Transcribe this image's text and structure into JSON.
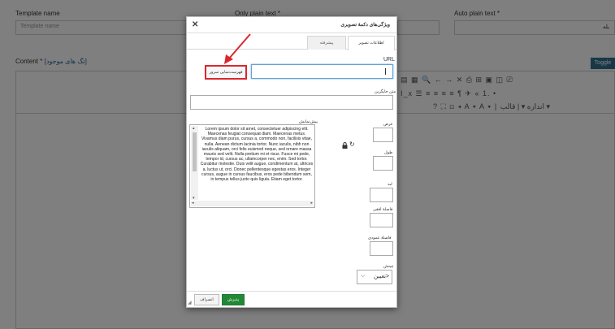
{
  "background": {
    "template_name_label": "Template name",
    "template_name_placeholder": "Template name",
    "only_plain_text_label": "Only plain text *",
    "auto_plain_text_label": "Auto plain text *",
    "auto_plain_text_value": "بله",
    "content_label": "Content *",
    "content_link": "[تگ های موجود]",
    "toggle_label": "Toggle",
    "toolbar_row1": "▤ ▦ 🔍 ← → ✕ ⎙ ⊞ ▣ ◫ ⎚",
    "toolbar_row2": "I_x ☰ ≡ ≡ ≡ ≡ ¶ ✈ « 1. •",
    "toolbar_row3": "? ⛶ ⊡ ◂ A ▾ A ▾ | اندازه ▾ | قالب ▾"
  },
  "dialog": {
    "title": "ویژگی‌های دکمهٔ تصویری",
    "tabs": {
      "image_info": "اطلاعات تصویر",
      "advanced": "پیشرفته"
    },
    "url_label": "URL",
    "browse_button": "فهرست‌نمایی سرور",
    "alt_label": "متن جایگزین",
    "preview_label": "پیش‌نمایش",
    "preview_text": "Lorem ipsum dolor sit amet, consectetuer adipiscing elit. Maecenas feugiat consequat diam. Maecenas metus. Vivamus diam purus, cursus a, commodo non, facilisis vitae, nulla. Aenean dictum lacinia tortor. Nunc iaculis, nibh non iaculis aliquam, orci felis euismod neque, sed ornare massa mauris sed velit. Nulla pretium mi et risus. Fusce mi pede, tempor id, cursus ac, ullamcorper nec, enim. Sed tortor. Curabitur molestie. Duis velit augue, condimentum at, ultrices a, luctus ut, orci. Donec pellentesque egestas eros. Integer cursus, augue in cursus faucibus, eros pede bibendum sem, in tempus tellus justo quis ligula. Etiam eget tortor.",
    "width_label": "عرض",
    "height_label": "طول",
    "border_label": "لبه",
    "hspace_label": "فاصلهٔ افقی",
    "vspace_label": "فاصلهٔ عمودی",
    "align_label": "چینش",
    "align_value": "<تعیین",
    "ok_button": "پذیرش",
    "cancel_button": "انصراف"
  }
}
